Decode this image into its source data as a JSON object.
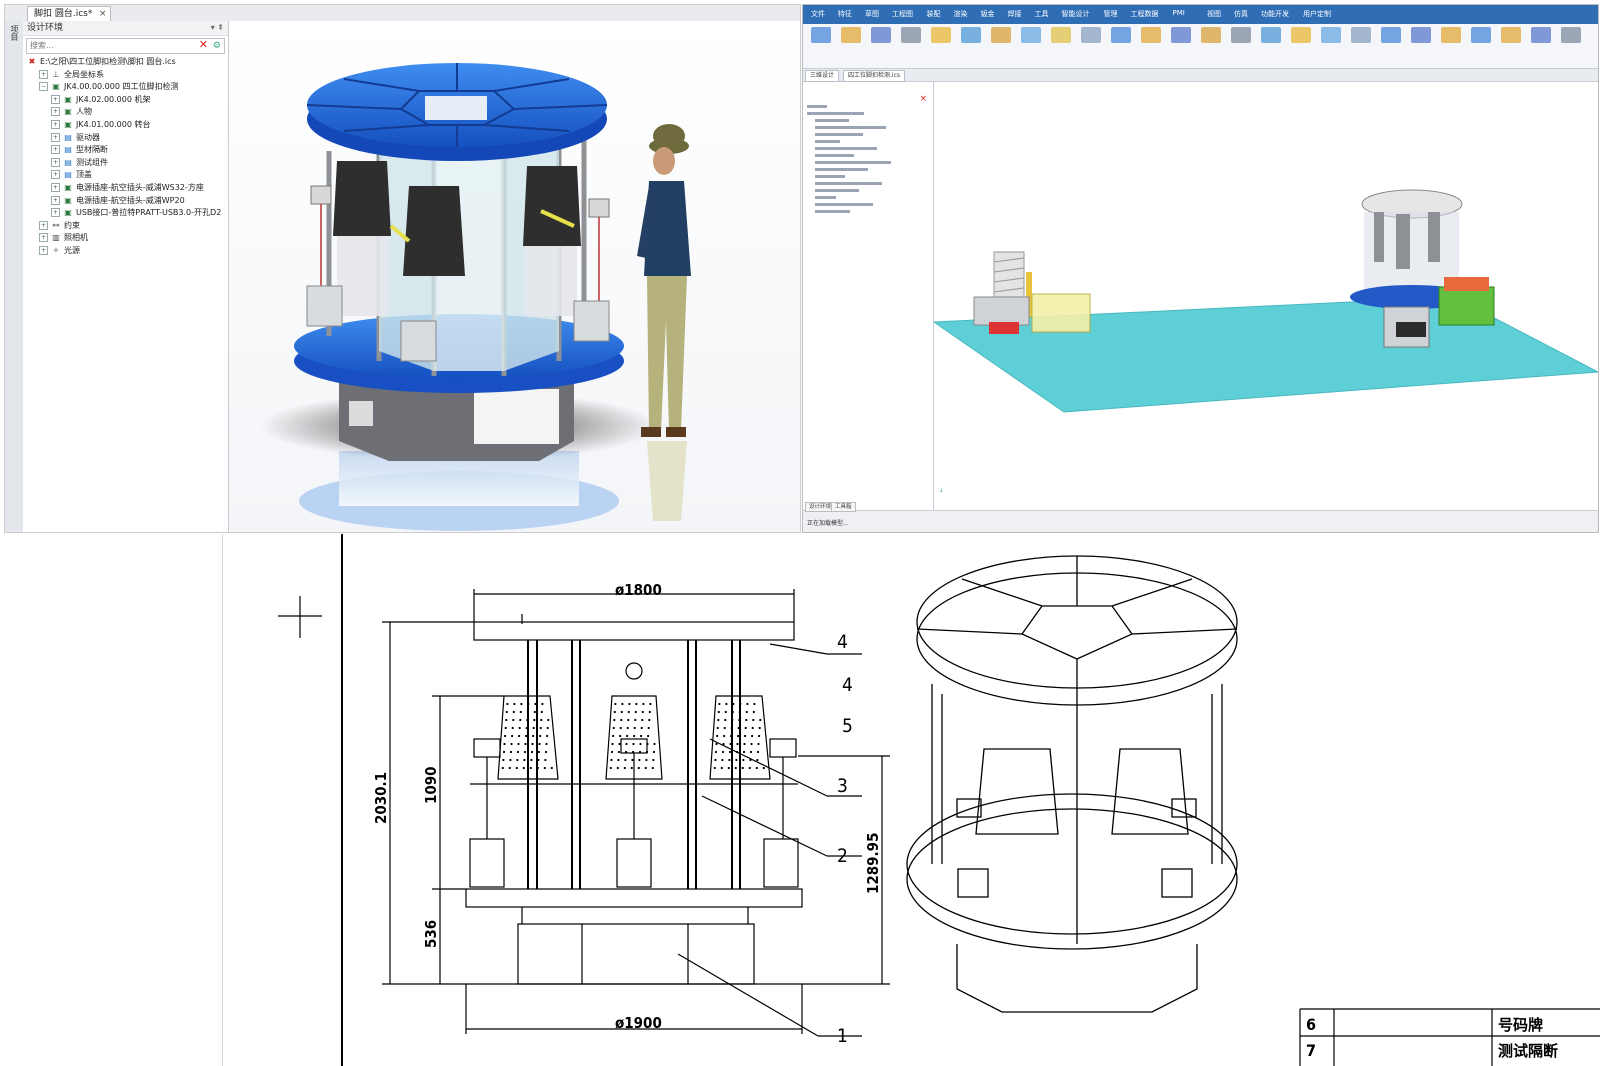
{
  "panel1": {
    "tab_title": "脚扣 圆台.ics*",
    "tab_close": "×",
    "side_label": "项目",
    "tree_header": "设计环境",
    "tree_header_pin": "▾ ⇞",
    "search_placeholder": "搜索...",
    "tree": [
      {
        "label": "E:\\之阳\\四工位脚扣检测\\脚扣 圆台.ics",
        "level": 0,
        "icon": "root-icon"
      },
      {
        "label": "全局坐标系",
        "level": 1,
        "icon": "coordinate-system-icon"
      },
      {
        "label": "JK4.00.00.000 四工位脚扣检测",
        "level": 1,
        "icon": "assembly-icon",
        "expanded": true
      },
      {
        "label": "JK4.02.00.000 机架",
        "level": 2,
        "icon": "assembly-icon"
      },
      {
        "label": "人物",
        "level": 2,
        "icon": "assembly-icon"
      },
      {
        "label": "JK4.01.00.000 转台",
        "level": 2,
        "icon": "assembly-icon"
      },
      {
        "label": "驱动器",
        "level": 2,
        "icon": "group-icon"
      },
      {
        "label": "型材隔断",
        "level": 2,
        "icon": "group-icon"
      },
      {
        "label": "测试组件",
        "level": 2,
        "icon": "group-icon"
      },
      {
        "label": "顶盖",
        "level": 2,
        "icon": "group-icon"
      },
      {
        "label": "电源插座-航空插头-威浦WS32-方座",
        "level": 2,
        "icon": "assembly-icon"
      },
      {
        "label": "电源插座-航空插头-威浦WP20",
        "level": 2,
        "icon": "assembly-icon"
      },
      {
        "label": "USB接口-普拉特PRATT-USB3.0-开孔D2",
        "level": 2,
        "icon": "assembly-icon"
      },
      {
        "label": "约束",
        "level": 1,
        "icon": "constraint-icon"
      },
      {
        "label": "照相机",
        "level": 1,
        "icon": "camera-icon"
      },
      {
        "label": "光源",
        "level": 1,
        "icon": "light-icon"
      }
    ],
    "colors": {
      "blue_top": "#1f5fd0",
      "panel_glass": "#d9ecef",
      "dark": "#2b2b2b"
    }
  },
  "panel2": {
    "ribbon_tabs": [
      "文件",
      "特征",
      "草图",
      "工程图",
      "装配",
      "渲染",
      "钣金",
      "焊接",
      "工具",
      "智能设计",
      "管理",
      "工程数据",
      "PMI",
      "视图",
      "仿真",
      "功能开发",
      "用户定制"
    ],
    "doc_tabs": [
      "三维设计",
      "四工位脚扣检测.ics"
    ],
    "tree_close": "×",
    "bottom_tabs": [
      "设计环境",
      "工具箱"
    ],
    "status_text": "正在加载模型...",
    "colors": {
      "floor": "#5ecfd6",
      "ribbon": "#2f6db5"
    }
  },
  "panel3": {
    "dim_top": "ø1800",
    "dim_bottom": "ø1900",
    "dim_height": "2030.1",
    "dim_1090": "1090",
    "dim_536": "536",
    "dim_1289": "1289.95",
    "balloons": [
      "4",
      "4",
      "5",
      "3",
      "2",
      "1"
    ],
    "table_row_no": "6",
    "table_row_name": "号码牌",
    "table_row_next": "7",
    "table_row_next_name": "测试隔断"
  }
}
